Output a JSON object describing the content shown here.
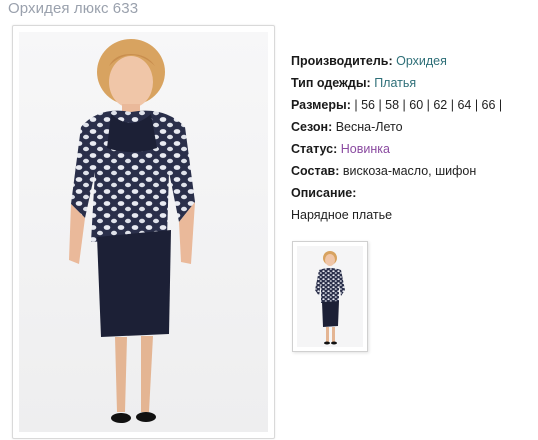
{
  "product": {
    "title": "Орхидея люкс 633"
  },
  "details": {
    "manufacturer_label": "Производитель:",
    "manufacturer_value": "Орхидея",
    "clothing_type_label": "Тип одежды:",
    "clothing_type_value": "Платья",
    "sizes_label": "Размеры:",
    "sizes_value": "| 56 | 58 | 60 | 62 | 64 | 66 |",
    "season_label": "Сезон:",
    "season_value": "Весна-Лето",
    "status_label": "Статус:",
    "status_value": "Новинка",
    "composition_label": "Состав:",
    "composition_value": "вискоза-масло, шифон",
    "description_label": "Описание:",
    "description_value": "Нарядное платье"
  },
  "colors": {
    "title": "#9aa1ad",
    "link": "#2e6f78",
    "status_link": "#8a4aa0",
    "dress_navy": "#1c2036"
  },
  "icons": {
    "main_image": "dress-photo",
    "thumbnail": "dress-thumbnail"
  }
}
